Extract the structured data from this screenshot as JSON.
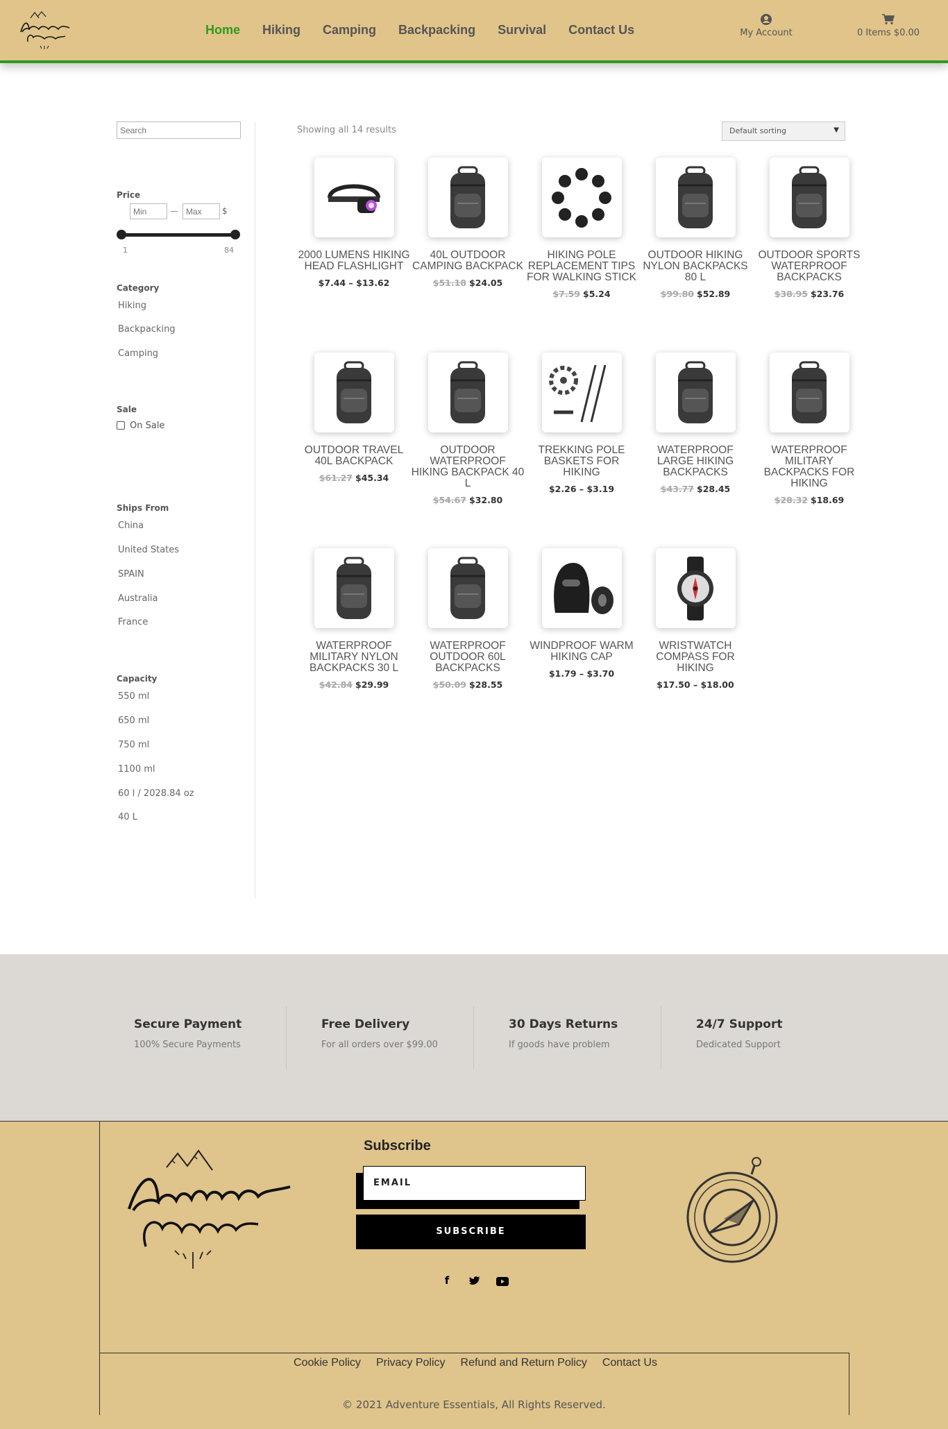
{
  "header": {
    "nav": [
      "Home",
      "Hiking",
      "Camping",
      "Backpacking",
      "Survival",
      "Contact Us"
    ],
    "active_nav": "Home",
    "account_label": "My Account",
    "cart_label": "0 Items $0.00",
    "accent_color": "#2e9a1f",
    "header_color": "#e0c48a"
  },
  "sidebar": {
    "search_placeholder": "Search",
    "price_heading": "Price",
    "price_min_placeholder": "Min",
    "price_max_placeholder": "Max",
    "price_dash": "—",
    "currency": "$",
    "slider_min": "1",
    "slider_max": "84",
    "category_heading": "Category",
    "categories": [
      "Hiking",
      "Backpacking",
      "Camping"
    ],
    "sale_heading": "Sale",
    "sale_option": "On Sale",
    "ships_heading": "Ships From",
    "ships": [
      "China",
      "United States",
      "SPAIN",
      "Australia",
      "France"
    ],
    "capacity_heading": "Capacity",
    "capacities": [
      "550 ml",
      "650 ml",
      "750 ml",
      "1100 ml",
      "60 l / 2028.84 oz",
      "40 L"
    ]
  },
  "shop": {
    "results_text": "Showing all 14 results",
    "sort_label": "Default sorting",
    "products": [
      {
        "title": "2000 LUMENS HIKING HEAD FLASHLIGHT",
        "old": "",
        "price": "$7.44 – $13.62",
        "icon": "headlamp-icon"
      },
      {
        "title": "40L OUTDOOR CAMPING BACKPACK",
        "old": "$51.18",
        "price": "$24.05",
        "icon": "backpack-icon"
      },
      {
        "title": "HIKING POLE REPLACEMENT TIPS FOR WALKING STICK",
        "old": "$7.59",
        "price": "$5.24",
        "icon": "pole-tips-icon"
      },
      {
        "title": "OUTDOOR HIKING NYLON BACKPACKS 80 L",
        "old": "$99.80",
        "price": "$52.89",
        "icon": "backpack-icon"
      },
      {
        "title": "OUTDOOR SPORTS WATERPROOF BACKPACKS",
        "old": "$38.95",
        "price": "$23.76",
        "icon": "backpack-icon"
      },
      {
        "title": "OUTDOOR TRAVEL 40L BACKPACK",
        "old": "$61.27",
        "price": "$45.34",
        "icon": "backpack-icon"
      },
      {
        "title": "OUTDOOR WATERPROOF HIKING BACKPACK 40 L",
        "old": "$54.67",
        "price": "$32.80",
        "icon": "backpack-icon"
      },
      {
        "title": "TREKKING POLE BASKETS FOR HIKING",
        "old": "",
        "price": "$2.26 – $3.19",
        "icon": "trekking-pole-icon"
      },
      {
        "title": "WATERPROOF LARGE HIKING BACKPACKS",
        "old": "$43.77",
        "price": "$28.45",
        "icon": "backpack-icon"
      },
      {
        "title": "WATERPROOF MILITARY BACKPACKS FOR HIKING",
        "old": "$28.32",
        "price": "$18.69",
        "icon": "backpack-icon"
      },
      {
        "title": "WATERPROOF MILITARY NYLON BACKPACKS 30 L",
        "old": "$42.84",
        "price": "$29.99",
        "icon": "backpack-icon"
      },
      {
        "title": "WATERPROOF OUTDOOR 60L BACKPACKS",
        "old": "$50.09",
        "price": "$28.55",
        "icon": "backpack-icon"
      },
      {
        "title": "WINDPROOF WARM HIKING CAP",
        "old": "",
        "price": "$1.79 – $3.70",
        "icon": "balaclava-icon"
      },
      {
        "title": "WRISTWATCH COMPASS FOR HIKING",
        "old": "",
        "price": "$17.50 – $18.00",
        "icon": "compass-watch-icon"
      }
    ]
  },
  "features": [
    {
      "title": "Secure Payment",
      "sub": "100% Secure Payments"
    },
    {
      "title": "Free Delivery",
      "sub": "For all orders over $99.00"
    },
    {
      "title": "30 Days Returns",
      "sub": "If goods have problem"
    },
    {
      "title": "24/7 Support",
      "sub": "Dedicated Support"
    }
  ],
  "footer": {
    "subscribe_title": "Subscribe",
    "email_placeholder": "EMAIL",
    "subscribe_button": "SUBSCRIBE",
    "social": [
      "f",
      "t",
      "▶"
    ],
    "links": [
      "Cookie Policy",
      "Privacy Policy",
      "Refund and Return Policy",
      "Contact Us"
    ],
    "copyright": "© 2021 Adventure Essentials, All Rights Reserved.",
    "footer_color": "#dfc48b"
  }
}
